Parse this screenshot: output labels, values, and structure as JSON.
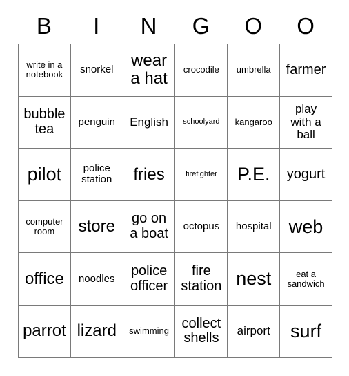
{
  "card": {
    "title_letters": [
      "B",
      "I",
      "N",
      "G",
      "O",
      "O"
    ],
    "rows": [
      [
        {
          "text": "write in a\nnotebook",
          "size": "fs-s"
        },
        {
          "text": "snorkel",
          "size": "fs-m"
        },
        {
          "text": "wear\na hat",
          "size": "fs-xxl"
        },
        {
          "text": "crocodile",
          "size": "fs-s"
        },
        {
          "text": "umbrella",
          "size": "fs-s"
        },
        {
          "text": "farmer",
          "size": "fs-xl"
        }
      ],
      [
        {
          "text": "bubble\ntea",
          "size": "fs-xl"
        },
        {
          "text": "penguin",
          "size": "fs-m"
        },
        {
          "text": "English",
          "size": "fs-l"
        },
        {
          "text": "schoolyard",
          "size": "fs-xs"
        },
        {
          "text": "kangaroo",
          "size": "fs-s"
        },
        {
          "text": "play\nwith a\nball",
          "size": "fs-l"
        }
      ],
      [
        {
          "text": "pilot",
          "size": "fs-huge"
        },
        {
          "text": "police\nstation",
          "size": "fs-m"
        },
        {
          "text": "fries",
          "size": "fs-xxl"
        },
        {
          "text": "firefighter",
          "size": "fs-xs"
        },
        {
          "text": "P.E.",
          "size": "fs-huge"
        },
        {
          "text": "yogurt",
          "size": "fs-xl"
        }
      ],
      [
        {
          "text": "computer\nroom",
          "size": "fs-s"
        },
        {
          "text": "store",
          "size": "fs-xxl"
        },
        {
          "text": "go on\na boat",
          "size": "fs-xl"
        },
        {
          "text": "octopus",
          "size": "fs-m"
        },
        {
          "text": "hospital",
          "size": "fs-m"
        },
        {
          "text": "web",
          "size": "fs-huge"
        }
      ],
      [
        {
          "text": "office",
          "size": "fs-xxl"
        },
        {
          "text": "noodles",
          "size": "fs-m"
        },
        {
          "text": "police\nofficer",
          "size": "fs-xl"
        },
        {
          "text": "fire\nstation",
          "size": "fs-xl"
        },
        {
          "text": "nest",
          "size": "fs-huge"
        },
        {
          "text": "eat a\nsandwich",
          "size": "fs-s"
        }
      ],
      [
        {
          "text": "parrot",
          "size": "fs-xxl"
        },
        {
          "text": "lizard",
          "size": "fs-xxl"
        },
        {
          "text": "swimming",
          "size": "fs-s"
        },
        {
          "text": "collect\nshells",
          "size": "fs-xl"
        },
        {
          "text": "airport",
          "size": "fs-l"
        },
        {
          "text": "surf",
          "size": "fs-huge"
        }
      ]
    ]
  }
}
